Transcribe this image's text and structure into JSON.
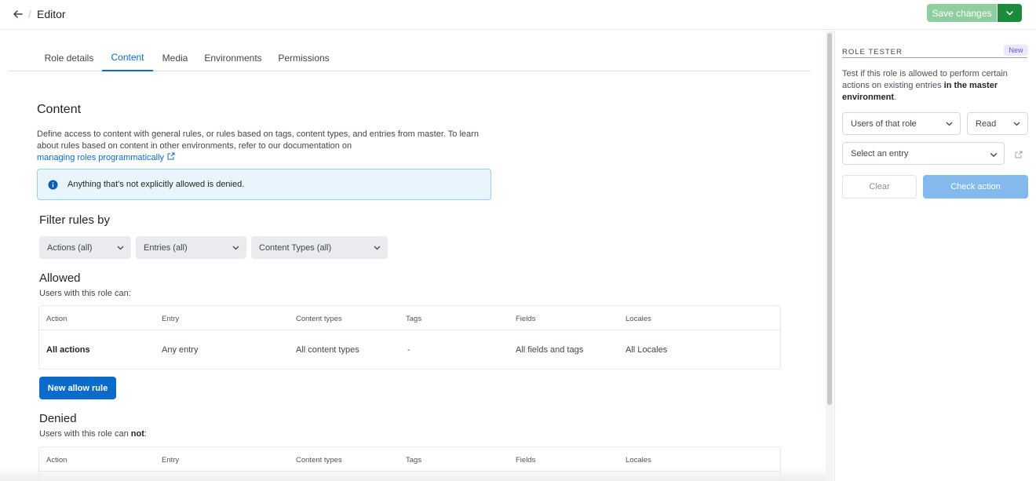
{
  "header": {
    "separator": "/",
    "title": "Editor",
    "save_label": "Save changes",
    "colors": {
      "save_disabled": "#8fcf9f",
      "save_caret": "#1b8a3b"
    }
  },
  "tabs": [
    {
      "label": "Role details",
      "active": false
    },
    {
      "label": "Content",
      "active": true
    },
    {
      "label": "Media",
      "active": false
    },
    {
      "label": "Environments",
      "active": false
    },
    {
      "label": "Permissions",
      "active": false
    }
  ],
  "content": {
    "title": "Content",
    "description": "Define access to content with general rules, or rules based on tags, content types, and entries from master. To learn about rules based on content in other environments, refer to our documentation on",
    "doc_link": "managing roles programmatically",
    "note": "Anything that's not explicitly allowed is denied."
  },
  "filter": {
    "title": "Filter rules by",
    "selects": [
      "Actions (all)",
      "Entries (all)",
      "Content Types (all)"
    ]
  },
  "allowed": {
    "title": "Allowed",
    "subtitle": "Users with this role can:",
    "columns": [
      "Action",
      "Entry",
      "Content types",
      "Tags",
      "Fields",
      "Locales"
    ],
    "rows": [
      [
        "All actions",
        "Any entry",
        "All content types",
        "-",
        "All fields and tags",
        "All Locales"
      ]
    ],
    "button": "New allow rule"
  },
  "denied": {
    "title": "Denied",
    "subtitle_prefix": "Users with this role can ",
    "subtitle_bold": "not",
    "subtitle_suffix": ":",
    "columns": [
      "Action",
      "Entry",
      "Content types",
      "Tags",
      "Fields",
      "Locales"
    ]
  },
  "role_tester": {
    "title": "ROLE TESTER",
    "badge": "New",
    "desc_plain": "Test if this role is allowed to perform certain actions on existing entries ",
    "desc_bold": "in the master environment",
    "desc_end": ".",
    "user_select": "Users of that role",
    "action_select": "Read",
    "entry_select": "Select an entry",
    "clear_label": "Clear",
    "check_label": "Check action"
  },
  "icons": {
    "back": "arrow-left-icon",
    "caret": "chevron-down-icon",
    "external": "external-link-icon",
    "info": "info-icon"
  }
}
